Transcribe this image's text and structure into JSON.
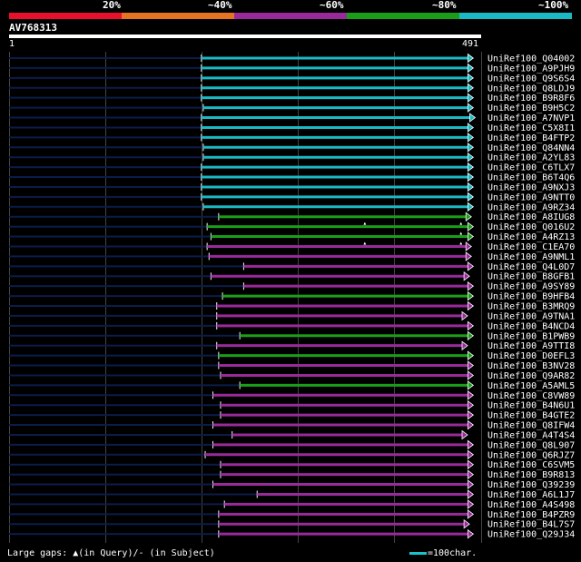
{
  "legend": {
    "labels": [
      "20%",
      "~40%",
      "~60%",
      "~80%",
      "~100%"
    ],
    "colors": [
      "#e8102d",
      "#e67322",
      "#982a9a",
      "#1a9e1a",
      "#1ab9c4"
    ]
  },
  "query": {
    "id": "AV768313",
    "start": "1",
    "end": "491",
    "length": 491
  },
  "colors": {
    "bracket20": "#e8102d",
    "bracket40": "#e67322",
    "bracket60": "#982a9a",
    "bracket80": "#1a9e1a",
    "bracket100": "#1ab9c4",
    "unaligned": "#0b1c4a",
    "grid": "#444444"
  },
  "footer": {
    "gaps_text": "Large gaps: ▲(in Query)/- (in Subject)",
    "key_text": "=100char."
  },
  "hits": [
    {
      "id": "UniRef100_Q04002",
      "s": 200,
      "e": 480,
      "c": "#1ab9c4"
    },
    {
      "id": "UniRef100_A9PJH9",
      "s": 200,
      "e": 480,
      "c": "#1ab9c4"
    },
    {
      "id": "UniRef100_Q9S6S4",
      "s": 200,
      "e": 480,
      "c": "#1ab9c4"
    },
    {
      "id": "UniRef100_Q8LDJ9",
      "s": 200,
      "e": 480,
      "c": "#1ab9c4"
    },
    {
      "id": "UniRef100_B9R8F6",
      "s": 200,
      "e": 480,
      "c": "#1ab9c4"
    },
    {
      "id": "UniRef100_B9H5C2",
      "s": 202,
      "e": 480,
      "c": "#1ab9c4"
    },
    {
      "id": "UniRef100_A7NVP1",
      "s": 200,
      "e": 482,
      "c": "#1ab9c4"
    },
    {
      "id": "UniRef100_C5X8I1",
      "s": 200,
      "e": 480,
      "c": "#1ab9c4"
    },
    {
      "id": "UniRef100_B4FTP2",
      "s": 200,
      "e": 480,
      "c": "#1ab9c4"
    },
    {
      "id": "UniRef100_Q84NN4",
      "s": 202,
      "e": 480,
      "c": "#1ab9c4"
    },
    {
      "id": "UniRef100_A2YL83",
      "s": 202,
      "e": 480,
      "c": "#1ab9c4"
    },
    {
      "id": "UniRef100_C6TLX7",
      "s": 200,
      "e": 480,
      "c": "#1ab9c4"
    },
    {
      "id": "UniRef100_B6T4Q6",
      "s": 200,
      "e": 480,
      "c": "#1ab9c4"
    },
    {
      "id": "UniRef100_A9NXJ3",
      "s": 200,
      "e": 480,
      "c": "#1ab9c4"
    },
    {
      "id": "UniRef100_A9NTT0",
      "s": 200,
      "e": 480,
      "c": "#1ab9c4"
    },
    {
      "id": "UniRef100_A9RZ34",
      "s": 202,
      "e": 480,
      "c": "#1ab9c4"
    },
    {
      "id": "UniRef100_A8IUG8",
      "s": 218,
      "e": 478,
      "c": "#1a9e1a"
    },
    {
      "id": "UniRef100_Q016U2",
      "s": 206,
      "e": 480,
      "c": "#1a9e1a"
    },
    {
      "id": "UniRef100_A4RZ13",
      "s": 210,
      "e": 480,
      "c": "#1a9e1a"
    },
    {
      "id": "UniRef100_C1EA70",
      "s": 206,
      "e": 478,
      "c": "#982a9a"
    },
    {
      "id": "UniRef100_A9NML1",
      "s": 208,
      "e": 478,
      "c": "#982a9a"
    },
    {
      "id": "UniRef100_Q4L0D7",
      "s": 244,
      "e": 480,
      "c": "#982a9a"
    },
    {
      "id": "UniRef100_B8GFB1",
      "s": 210,
      "e": 476,
      "c": "#982a9a"
    },
    {
      "id": "UniRef100_A9SY89",
      "s": 244,
      "e": 480,
      "c": "#982a9a"
    },
    {
      "id": "UniRef100_B9HFB4",
      "s": 222,
      "e": 480,
      "c": "#1a9e1a"
    },
    {
      "id": "UniRef100_B3MRQ9",
      "s": 216,
      "e": 480,
      "c": "#982a9a"
    },
    {
      "id": "UniRef100_A9TNA1",
      "s": 216,
      "e": 474,
      "c": "#982a9a"
    },
    {
      "id": "UniRef100_B4NCD4",
      "s": 216,
      "e": 480,
      "c": "#982a9a"
    },
    {
      "id": "UniRef100_B1PWB9",
      "s": 240,
      "e": 480,
      "c": "#1a9e1a"
    },
    {
      "id": "UniRef100_A9TTI8",
      "s": 216,
      "e": 474,
      "c": "#982a9a"
    },
    {
      "id": "UniRef100_D0EFL3",
      "s": 218,
      "e": 480,
      "c": "#1a9e1a"
    },
    {
      "id": "UniRef100_B3NV28",
      "s": 218,
      "e": 480,
      "c": "#982a9a"
    },
    {
      "id": "UniRef100_Q9AR82",
      "s": 220,
      "e": 480,
      "c": "#982a9a"
    },
    {
      "id": "UniRef100_A5AML5",
      "s": 240,
      "e": 480,
      "c": "#1a9e1a"
    },
    {
      "id": "UniRef100_C8VW89",
      "s": 212,
      "e": 480,
      "c": "#982a9a"
    },
    {
      "id": "UniRef100_B4N6U1",
      "s": 220,
      "e": 480,
      "c": "#982a9a"
    },
    {
      "id": "UniRef100_B4GTE2",
      "s": 220,
      "e": 480,
      "c": "#982a9a"
    },
    {
      "id": "UniRef100_Q8IFW4",
      "s": 212,
      "e": 480,
      "c": "#982a9a"
    },
    {
      "id": "UniRef100_A4T4S4",
      "s": 232,
      "e": 474,
      "c": "#982a9a"
    },
    {
      "id": "UniRef100_Q8L907",
      "s": 212,
      "e": 480,
      "c": "#982a9a"
    },
    {
      "id": "UniRef100_Q6RJZ7",
      "s": 204,
      "e": 480,
      "c": "#982a9a"
    },
    {
      "id": "UniRef100_C6SVM5",
      "s": 220,
      "e": 480,
      "c": "#982a9a"
    },
    {
      "id": "UniRef100_B9R813",
      "s": 220,
      "e": 480,
      "c": "#982a9a"
    },
    {
      "id": "UniRef100_Q39239",
      "s": 212,
      "e": 480,
      "c": "#982a9a"
    },
    {
      "id": "UniRef100_A6L1J7",
      "s": 258,
      "e": 480,
      "c": "#982a9a"
    },
    {
      "id": "UniRef100_A4S498",
      "s": 224,
      "e": 480,
      "c": "#982a9a"
    },
    {
      "id": "UniRef100_B4PZR9",
      "s": 218,
      "e": 480,
      "c": "#982a9a"
    },
    {
      "id": "UniRef100_B4L7S7",
      "s": 218,
      "e": 476,
      "c": "#982a9a"
    },
    {
      "id": "UniRef100_Q29J34",
      "s": 218,
      "e": 480,
      "c": "#982a9a"
    }
  ],
  "query_gaps": [
    {
      "row": 17,
      "pos": 370
    },
    {
      "row": 17,
      "pos": 470
    },
    {
      "row": 18,
      "pos": 470
    },
    {
      "row": 19,
      "pos": 370
    },
    {
      "row": 19,
      "pos": 470
    }
  ]
}
